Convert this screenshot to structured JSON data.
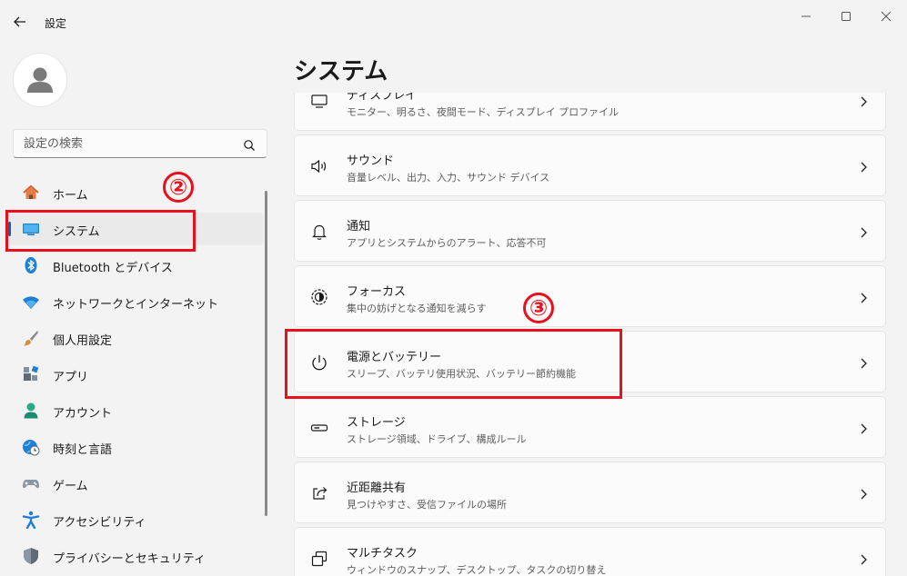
{
  "window": {
    "title": "設定"
  },
  "sidebar": {
    "search_placeholder": "設定の検索",
    "items": [
      {
        "label": "ホーム",
        "icon": "home-icon"
      },
      {
        "label": "システム",
        "icon": "system-icon",
        "selected": true
      },
      {
        "label": "Bluetooth とデバイス",
        "icon": "bluetooth-icon"
      },
      {
        "label": "ネットワークとインターネット",
        "icon": "wifi-icon"
      },
      {
        "label": "個人用設定",
        "icon": "brush-icon"
      },
      {
        "label": "アプリ",
        "icon": "apps-icon"
      },
      {
        "label": "アカウント",
        "icon": "account-icon"
      },
      {
        "label": "時刻と言語",
        "icon": "clock-globe-icon"
      },
      {
        "label": "ゲーム",
        "icon": "gamepad-icon"
      },
      {
        "label": "アクセシビリティ",
        "icon": "accessibility-icon"
      },
      {
        "label": "プライバシーとセキュリティ",
        "icon": "shield-icon"
      }
    ]
  },
  "main": {
    "title": "システム",
    "rows": [
      {
        "title": "ディスプレイ",
        "subtitle": "モニター、明るさ、夜間モード、ディスプレイ プロファイル",
        "icon": "display-icon"
      },
      {
        "title": "サウンド",
        "subtitle": "音量レベル、出力、入力、サウンド デバイス",
        "icon": "speaker-icon"
      },
      {
        "title": "通知",
        "subtitle": "アプリとシステムからのアラート、応答不可",
        "icon": "bell-icon"
      },
      {
        "title": "フォーカス",
        "subtitle": "集中の妨げとなる通知を減らす",
        "icon": "focus-icon"
      },
      {
        "title": "電源とバッテリー",
        "subtitle": "スリープ、バッテリ使用状況、バッテリー節約機能",
        "icon": "power-icon"
      },
      {
        "title": "ストレージ",
        "subtitle": "ストレージ領域、ドライブ、構成ルール",
        "icon": "storage-icon"
      },
      {
        "title": "近距離共有",
        "subtitle": "見つけやすさ、受信ファイルの場所",
        "icon": "share-icon"
      },
      {
        "title": "マルチタスク",
        "subtitle": "ウィンドウのスナップ、デスクトップ、タスクの切り替え",
        "icon": "multitask-icon"
      }
    ]
  },
  "annotations": {
    "step2": "②",
    "step3": "③",
    "color": "#e8101c"
  },
  "colors": {
    "accent": "#0067c0",
    "background": "#f3f3f3",
    "card": "#fbfbfb"
  }
}
